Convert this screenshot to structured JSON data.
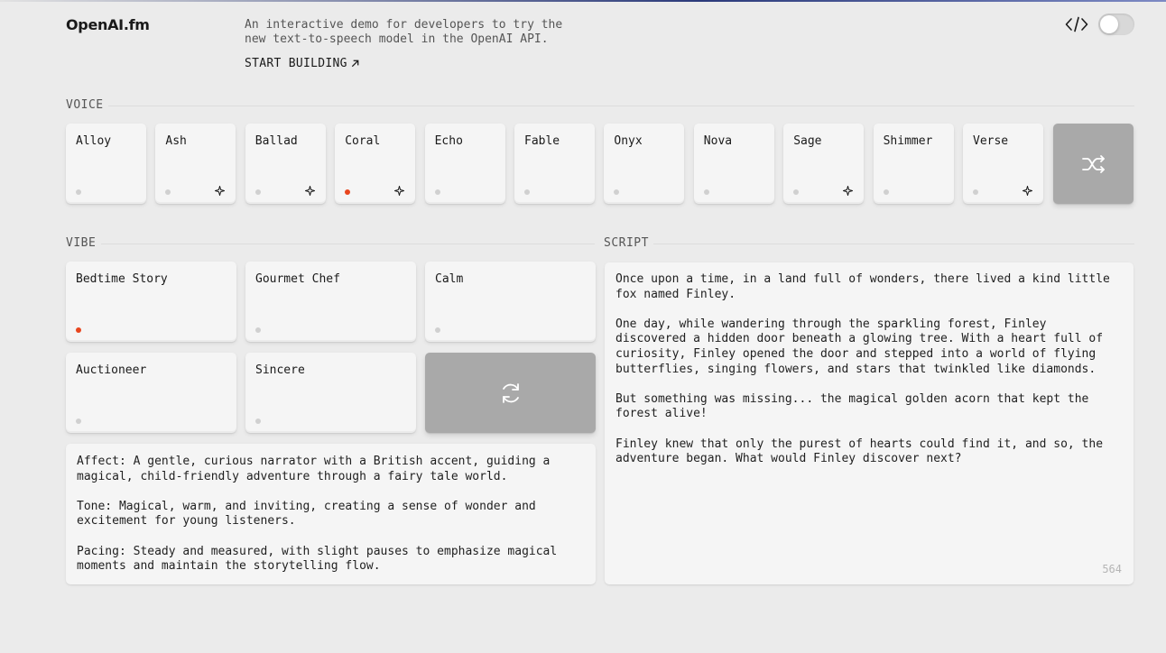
{
  "header": {
    "logo": "OpenAI.fm",
    "tagline": "An interactive demo for developers to try the new text-to-speech model in the OpenAI API.",
    "start_label": "START BUILDING",
    "start_icon": "arrow-up-right-icon",
    "code_icon": "code-icon",
    "toggle_on": false
  },
  "voice": {
    "label": "VOICE",
    "items": [
      {
        "label": "Alloy",
        "active": false,
        "new": false
      },
      {
        "label": "Ash",
        "active": false,
        "new": true
      },
      {
        "label": "Ballad",
        "active": false,
        "new": true
      },
      {
        "label": "Coral",
        "active": true,
        "new": true
      },
      {
        "label": "Echo",
        "active": false,
        "new": false
      },
      {
        "label": "Fable",
        "active": false,
        "new": false
      },
      {
        "label": "Onyx",
        "active": false,
        "new": false
      },
      {
        "label": "Nova",
        "active": false,
        "new": false
      },
      {
        "label": "Sage",
        "active": false,
        "new": true
      },
      {
        "label": "Shimmer",
        "active": false,
        "new": false
      },
      {
        "label": "Verse",
        "active": false,
        "new": true
      }
    ],
    "shuffle_icon": "shuffle-icon"
  },
  "vibe": {
    "label": "VIBE",
    "items": [
      {
        "label": "Bedtime Story",
        "active": true
      },
      {
        "label": "Gourmet Chef",
        "active": false
      },
      {
        "label": "Calm",
        "active": false
      },
      {
        "label": "Auctioneer",
        "active": false
      },
      {
        "label": "Sincere",
        "active": false
      }
    ],
    "refresh_icon": "refresh-icon",
    "description": [
      "Affect: A gentle, curious narrator with a British accent, guiding a magical, child-friendly adventure through a fairy tale world.",
      "Tone: Magical, warm, and inviting, creating a sense of wonder and excitement for young listeners.",
      "Pacing: Steady and measured, with slight pauses to emphasize magical moments and maintain the storytelling flow."
    ]
  },
  "script": {
    "label": "SCRIPT",
    "paragraphs": [
      "Once upon a time, in a land full of wonders, there lived a kind little fox named Finley.",
      "One day, while wandering through the sparkling forest, Finley discovered a hidden door beneath a glowing tree. With a heart full of curiosity, Finley opened the door and stepped into a world of flying butterflies, singing flowers, and stars that twinkled like diamonds.",
      "But something was missing... the magical golden acorn that kept the forest alive!",
      "Finley knew that only the purest of hearts could find it, and so, the adventure began. What would Finley discover next?"
    ],
    "char_count": "564"
  },
  "colors": {
    "accent": "#e8461e",
    "background": "#ebebeb",
    "card": "#f5f5f5",
    "dark_card": "#a9a9a9"
  }
}
